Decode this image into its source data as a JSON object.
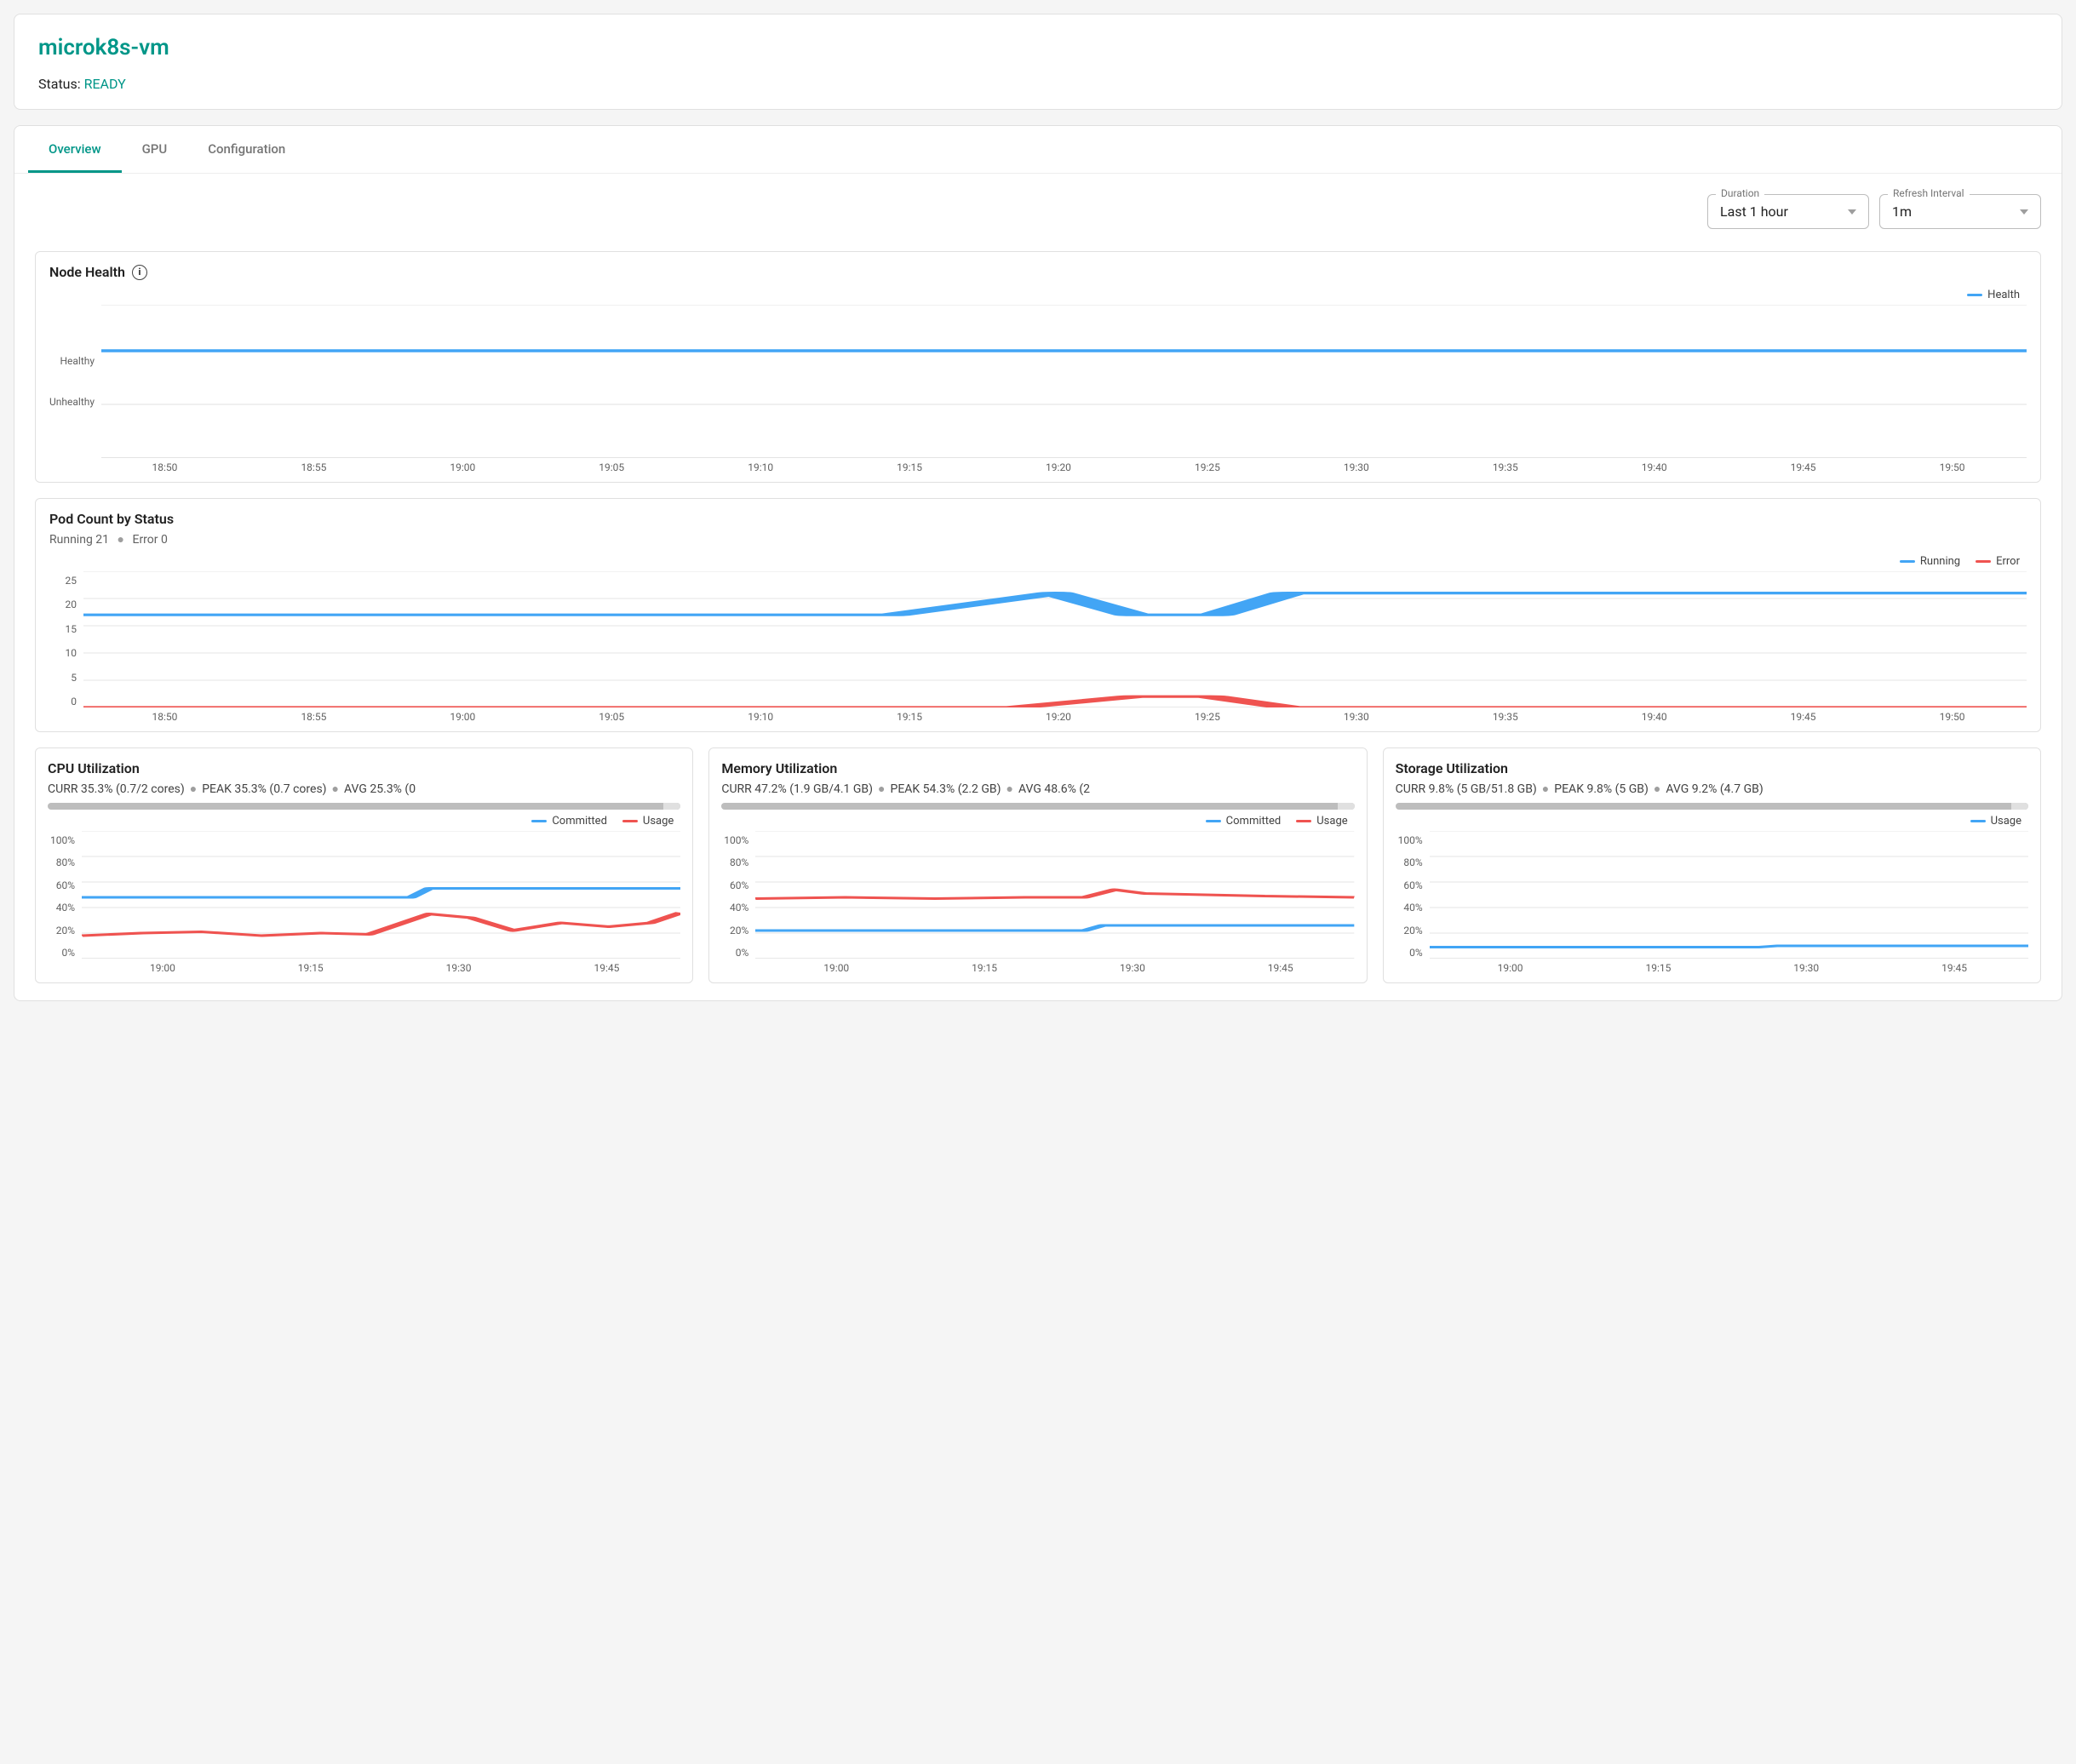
{
  "header": {
    "title": "microk8s-vm",
    "status_label": "Status:",
    "status_value": "READY"
  },
  "tabs": [
    {
      "label": "Overview",
      "active": true
    },
    {
      "label": "GPU",
      "active": false
    },
    {
      "label": "Configuration",
      "active": false
    }
  ],
  "controls": {
    "duration_label": "Duration",
    "duration_value": "Last 1 hour",
    "refresh_label": "Refresh Interval",
    "refresh_value": "1m"
  },
  "colors": {
    "blue": "#42a5f5",
    "red": "#ef5350"
  },
  "node_health": {
    "title": "Node Health",
    "legend": [
      {
        "label": "Health",
        "color": "#42a5f5"
      }
    ],
    "y_ticks": [
      "Healthy",
      "Unhealthy"
    ],
    "x_ticks": [
      "18:50",
      "18:55",
      "19:00",
      "19:05",
      "19:10",
      "19:15",
      "19:20",
      "19:25",
      "19:30",
      "19:35",
      "19:40",
      "19:45",
      "19:50"
    ]
  },
  "pod_count": {
    "title": "Pod Count by Status",
    "subtitle_running_label": "Running",
    "subtitle_running_value": "21",
    "subtitle_error_label": "Error",
    "subtitle_error_value": "0",
    "legend": [
      {
        "label": "Running",
        "color": "#42a5f5"
      },
      {
        "label": "Error",
        "color": "#ef5350"
      }
    ],
    "y_ticks": [
      "25",
      "20",
      "15",
      "10",
      "5",
      "0"
    ],
    "x_ticks": [
      "18:50",
      "18:55",
      "19:00",
      "19:05",
      "19:10",
      "19:15",
      "19:20",
      "19:25",
      "19:30",
      "19:35",
      "19:40",
      "19:45",
      "19:50"
    ]
  },
  "cpu_util": {
    "title": "CPU Utilization",
    "curr": "CURR 35.3% (0.7/2 cores)",
    "peak": "PEAK 35.3% (0.7 cores)",
    "avg": "AVG 25.3% (0",
    "legend": [
      {
        "label": "Committed",
        "color": "#42a5f5"
      },
      {
        "label": "Usage",
        "color": "#ef5350"
      }
    ],
    "y_ticks": [
      "100%",
      "80%",
      "60%",
      "40%",
      "20%",
      "0%"
    ],
    "x_ticks": [
      "19:00",
      "19:15",
      "19:30",
      "19:45"
    ]
  },
  "mem_util": {
    "title": "Memory Utilization",
    "curr": "CURR 47.2% (1.9 GB/4.1 GB)",
    "peak": "PEAK 54.3% (2.2 GB)",
    "avg": "AVG 48.6% (2",
    "legend": [
      {
        "label": "Committed",
        "color": "#42a5f5"
      },
      {
        "label": "Usage",
        "color": "#ef5350"
      }
    ],
    "y_ticks": [
      "100%",
      "80%",
      "60%",
      "40%",
      "20%",
      "0%"
    ],
    "x_ticks": [
      "19:00",
      "19:15",
      "19:30",
      "19:45"
    ]
  },
  "storage_util": {
    "title": "Storage Utilization",
    "curr": "CURR 9.8% (5 GB/51.8 GB)",
    "peak": "PEAK 9.8% (5 GB)",
    "avg": "AVG 9.2% (4.7 GB)",
    "legend": [
      {
        "label": "Usage",
        "color": "#42a5f5"
      }
    ],
    "y_ticks": [
      "100%",
      "80%",
      "60%",
      "40%",
      "20%",
      "0%"
    ],
    "x_ticks": [
      "19:00",
      "19:15",
      "19:30",
      "19:45"
    ]
  },
  "chart_data": [
    {
      "id": "node_health",
      "type": "line",
      "title": "Node Health",
      "x": [
        "18:50",
        "18:55",
        "19:00",
        "19:05",
        "19:10",
        "19:15",
        "19:20",
        "19:25",
        "19:30",
        "19:35",
        "19:40",
        "19:45",
        "19:50"
      ],
      "y_categories": [
        "Unhealthy",
        "Healthy"
      ],
      "series": [
        {
          "name": "Health",
          "color": "#42a5f5",
          "values": [
            "Healthy",
            "Healthy",
            "Healthy",
            "Healthy",
            "Healthy",
            "Healthy",
            "Healthy",
            "Healthy",
            "Healthy",
            "Healthy",
            "Healthy",
            "Healthy",
            "Healthy"
          ]
        }
      ]
    },
    {
      "id": "pod_count",
      "type": "line",
      "title": "Pod Count by Status",
      "x": [
        "18:50",
        "18:55",
        "19:00",
        "19:05",
        "19:10",
        "19:15",
        "19:20",
        "19:25",
        "19:30",
        "19:35",
        "19:40",
        "19:45",
        "19:50"
      ],
      "ylim": [
        0,
        25
      ],
      "series": [
        {
          "name": "Running",
          "color": "#42a5f5",
          "values": [
            17,
            17,
            17,
            17,
            17,
            17,
            21,
            17,
            21,
            21,
            21,
            21,
            21
          ]
        },
        {
          "name": "Error",
          "color": "#ef5350",
          "values": [
            0,
            0,
            0,
            0,
            0,
            0,
            0,
            2,
            0,
            0,
            0,
            0,
            0
          ]
        }
      ]
    },
    {
      "id": "cpu_util",
      "type": "line",
      "title": "CPU Utilization",
      "x": [
        "18:50",
        "18:55",
        "19:00",
        "19:05",
        "19:10",
        "19:15",
        "19:20",
        "19:25",
        "19:30",
        "19:35",
        "19:40",
        "19:45",
        "19:50"
      ],
      "ylim": [
        0,
        100
      ],
      "ylabel": "%",
      "series": [
        {
          "name": "Committed",
          "color": "#42a5f5",
          "values": [
            48,
            48,
            48,
            48,
            48,
            48,
            48,
            55,
            55,
            55,
            55,
            55,
            55
          ]
        },
        {
          "name": "Usage",
          "color": "#ef5350",
          "values": [
            18,
            20,
            21,
            19,
            20,
            19,
            20,
            35,
            32,
            22,
            28,
            25,
            28
          ]
        }
      ],
      "stats": {
        "curr_pct": 35.3,
        "curr_detail": "0.7/2 cores",
        "peak_pct": 35.3,
        "peak_detail": "0.7 cores",
        "avg_pct": 25.3
      }
    },
    {
      "id": "mem_util",
      "type": "line",
      "title": "Memory Utilization",
      "x": [
        "18:50",
        "18:55",
        "19:00",
        "19:05",
        "19:10",
        "19:15",
        "19:20",
        "19:25",
        "19:30",
        "19:35",
        "19:40",
        "19:45",
        "19:50"
      ],
      "ylim": [
        0,
        100
      ],
      "ylabel": "%",
      "series": [
        {
          "name": "Committed",
          "color": "#42a5f5",
          "values": [
            22,
            22,
            22,
            22,
            22,
            22,
            22,
            26,
            26,
            26,
            26,
            26,
            26
          ]
        },
        {
          "name": "Usage",
          "color": "#ef5350",
          "values": [
            47,
            48,
            47,
            48,
            47,
            48,
            48,
            54,
            51,
            50,
            50,
            49,
            48
          ]
        }
      ],
      "stats": {
        "curr_pct": 47.2,
        "curr_detail": "1.9 GB/4.1 GB",
        "peak_pct": 54.3,
        "peak_detail": "2.2 GB",
        "avg_pct": 48.6
      }
    },
    {
      "id": "storage_util",
      "type": "line",
      "title": "Storage Utilization",
      "x": [
        "18:50",
        "18:55",
        "19:00",
        "19:05",
        "19:10",
        "19:15",
        "19:20",
        "19:25",
        "19:30",
        "19:35",
        "19:40",
        "19:45",
        "19:50"
      ],
      "ylim": [
        0,
        100
      ],
      "ylabel": "%",
      "series": [
        {
          "name": "Usage",
          "color": "#42a5f5",
          "values": [
            9,
            9,
            9,
            9,
            9,
            9,
            9,
            10,
            10,
            10,
            10,
            10,
            10
          ]
        }
      ],
      "stats": {
        "curr_pct": 9.8,
        "curr_detail": "5 GB/51.8 GB",
        "peak_pct": 9.8,
        "peak_detail": "5 GB",
        "avg_pct": 9.2,
        "avg_detail": "4.7 GB"
      }
    }
  ]
}
